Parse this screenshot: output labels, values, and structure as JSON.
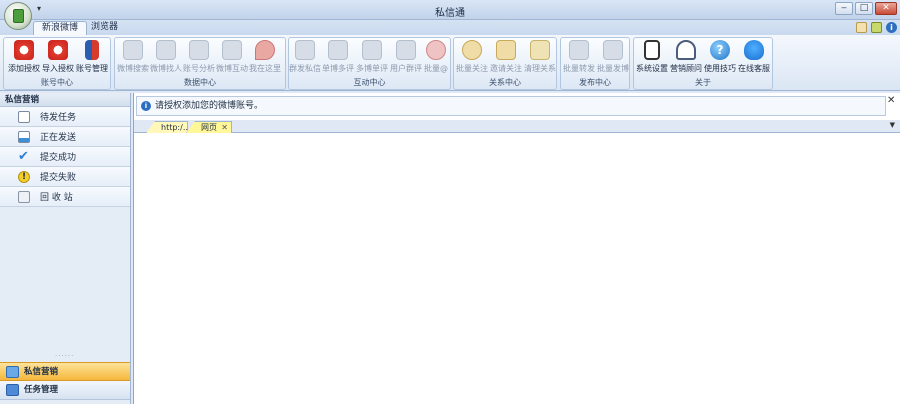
{
  "window": {
    "title": "私信通"
  },
  "ribbon_tabs": [
    {
      "label": "新浪微博"
    },
    {
      "label": "浏览器"
    }
  ],
  "groups": [
    {
      "label": "账号中心",
      "buttons": [
        {
          "label": "添加授权"
        },
        {
          "label": "导入授权"
        },
        {
          "label": "账号管理"
        }
      ]
    },
    {
      "label": "数据中心",
      "buttons": [
        {
          "label": "微博搜索"
        },
        {
          "label": "微博找人"
        },
        {
          "label": "账号分析"
        },
        {
          "label": "微博互动"
        },
        {
          "label": "我在这里"
        }
      ]
    },
    {
      "label": "互动中心",
      "buttons": [
        {
          "label": "群发私信"
        },
        {
          "label": "单博多评"
        },
        {
          "label": "多博单评"
        },
        {
          "label": "用户群评"
        },
        {
          "label": "批量@"
        }
      ]
    },
    {
      "label": "关系中心",
      "buttons": [
        {
          "label": "批量关注"
        },
        {
          "label": "邀请关注"
        },
        {
          "label": "清理关系"
        }
      ]
    },
    {
      "label": "发布中心",
      "buttons": [
        {
          "label": "批量转发"
        },
        {
          "label": "批量发博"
        }
      ]
    },
    {
      "label": "关于",
      "buttons": [
        {
          "label": "系统设置"
        },
        {
          "label": "营销顾问"
        },
        {
          "label": "使用技巧"
        },
        {
          "label": "在线客服"
        }
      ]
    }
  ],
  "sidebar": {
    "header": "私信营销",
    "items": [
      {
        "label": "待发任务"
      },
      {
        "label": "正在发送"
      },
      {
        "label": "提交成功"
      },
      {
        "label": "提交失败"
      },
      {
        "label": "回 收 站"
      }
    ],
    "bottom_tabs": [
      {
        "label": "私信营销"
      },
      {
        "label": "任务管理"
      }
    ]
  },
  "main": {
    "info_message": "请授权添加您的微博账号。",
    "doc_tabs": [
      {
        "label": "http:/..."
      },
      {
        "label": "网页"
      }
    ]
  }
}
